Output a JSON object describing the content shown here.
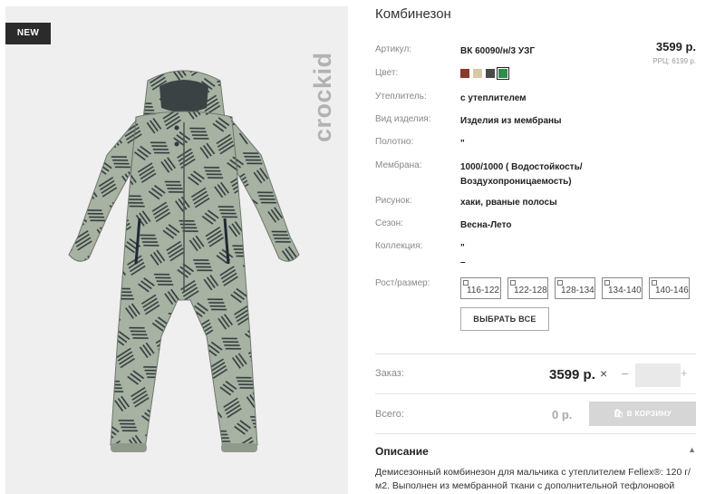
{
  "gallery": {
    "badge": "NEW",
    "brand_watermark": "crockid"
  },
  "product": {
    "title": "Комбинезон",
    "price": "3599 р.",
    "rrp": "РРЦ: 6199 р.",
    "specs": [
      {
        "label": "Артикул:",
        "value": "ВК 60090/н/3 УЗГ"
      },
      {
        "label": "Цвет:",
        "value": ""
      },
      {
        "label": "Утеплитель:",
        "value": "с утеплителем"
      },
      {
        "label": "Вид изделия:",
        "value": "Изделия из мембраны"
      },
      {
        "label": "Полотно:",
        "value": "\""
      },
      {
        "label": "Мембрана:",
        "value": "1000/1000 ( Водостойкость/ Воздухопроницаемость)"
      },
      {
        "label": "Рисунок:",
        "value": "хаки, рваные полосы"
      },
      {
        "label": "Сезон:",
        "value": "Весна-Лето"
      },
      {
        "label": "Коллекция:",
        "value": "\" –"
      },
      {
        "label": "Рост/размер:",
        "value": ""
      }
    ],
    "swatches": [
      {
        "color": "#8b3a28",
        "selected": false
      },
      {
        "color": "#d8c7a4",
        "selected": false
      },
      {
        "color": "#4a4a4a",
        "selected": false
      },
      {
        "color": "#2e8b4a",
        "selected": true
      }
    ],
    "sizes": [
      "116-122",
      "122-128",
      "128-134",
      "134-140",
      "140-146"
    ],
    "select_all": "ВЫБРАТЬ ВСЕ"
  },
  "order": {
    "label": "Заказ:",
    "price": "3599 р.",
    "times": "×",
    "minus": "–",
    "plus": "+",
    "quantity": ""
  },
  "total": {
    "label": "Всего:",
    "value": "0 р.",
    "cart_button": "В КОРЗИНУ"
  },
  "description": {
    "title": "Описание",
    "caret": "▲",
    "text": "Демисезонный комбинезон для мальчика с утеплителем Fellex®: 120 г/м2. Выполнен из мембранной ткани с дополнительной тефлоновой"
  },
  "colors": {
    "suit_base": "#a7b2a3",
    "suit_pattern": "#2f3a3c",
    "badge_bg": "#2b2b2b"
  }
}
